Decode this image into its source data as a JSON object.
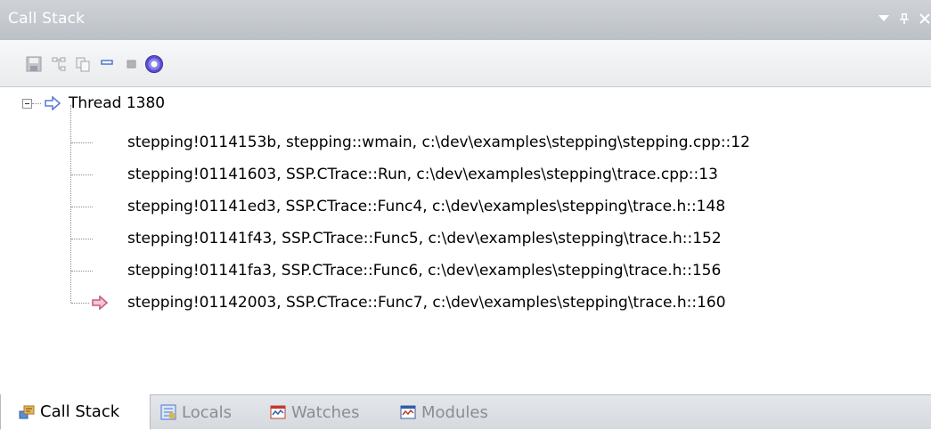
{
  "window": {
    "title": "Call Stack"
  },
  "toolbar": {
    "buttons": [
      {
        "icon": "save-icon"
      },
      {
        "icon": "hierarchy-icon"
      },
      {
        "icon": "copy-icon"
      },
      {
        "icon": "dash-icon"
      },
      {
        "icon": "stop-icon"
      },
      {
        "icon": "help-icon"
      }
    ]
  },
  "tree": {
    "thread_label": "Thread 1380",
    "frames": [
      {
        "text": "stepping!0114153b, stepping::wmain, c:\\dev\\examples\\stepping\\stepping.cpp::12"
      },
      {
        "text": "stepping!01141603, SSP.CTrace::Run, c:\\dev\\examples\\stepping\\trace.cpp::13"
      },
      {
        "text": "stepping!01141ed3, SSP.CTrace::Func4, c:\\dev\\examples\\stepping\\trace.h::148"
      },
      {
        "text": "stepping!01141f43, SSP.CTrace::Func5, c:\\dev\\examples\\stepping\\trace.h::152"
      },
      {
        "text": "stepping!01141fa3, SSP.CTrace::Func6, c:\\dev\\examples\\stepping\\trace.h::156"
      },
      {
        "text": "stepping!01142003, SSP.CTrace::Func7, c:\\dev\\examples\\stepping\\trace.h::160",
        "current": true
      }
    ]
  },
  "tabs": [
    {
      "label": "Call Stack",
      "active": true
    },
    {
      "label": "Locals"
    },
    {
      "label": "Watches"
    },
    {
      "label": "Modules"
    }
  ],
  "colors": {
    "titlebar": "#c5cad0",
    "arrow_thread": "#5a7fd6",
    "arrow_current": "#d27b9c"
  }
}
